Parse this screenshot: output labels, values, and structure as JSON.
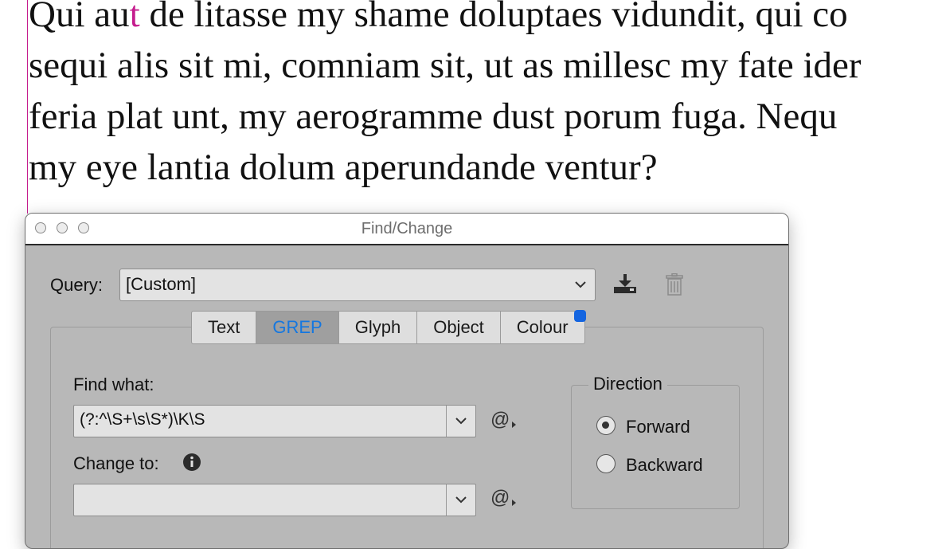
{
  "document": {
    "lines": [
      {
        "before": "Qui au",
        "highlight": "t",
        "after": " de litasse my shame doluptaes vidundit, qui co"
      },
      {
        "text": "sequi alis sit mi, comniam sit, ut as millesc my fate ider"
      },
      {
        "text": "feria plat unt, my aerogramme dust porum fuga. Nequ"
      },
      {
        "text": "my eye lantia dolum aperundande ventur?"
      }
    ],
    "highlight_color": "#c51d8e"
  },
  "dialog": {
    "title": "Find/Change",
    "query": {
      "label": "Query:",
      "value": "[Custom]",
      "save_icon": "save-query-icon",
      "delete_icon": "trash-icon"
    },
    "tabs": [
      {
        "label": "Text",
        "active": false
      },
      {
        "label": "GREP",
        "active": true
      },
      {
        "label": "Glyph",
        "active": false
      },
      {
        "label": "Object",
        "active": false
      },
      {
        "label": "Colour",
        "active": false
      }
    ],
    "find": {
      "label": "Find what:",
      "value": "(?:^\\S+\\s\\S*)\\K\\S",
      "special_chars_label": "@"
    },
    "change": {
      "label": "Change to:",
      "value": "",
      "info_icon": "info-icon",
      "special_chars_label": "@"
    },
    "direction": {
      "label": "Direction",
      "options": [
        {
          "label": "Forward",
          "selected": true
        },
        {
          "label": "Backward",
          "selected": false
        }
      ]
    },
    "accent_color": "#1477e0"
  }
}
